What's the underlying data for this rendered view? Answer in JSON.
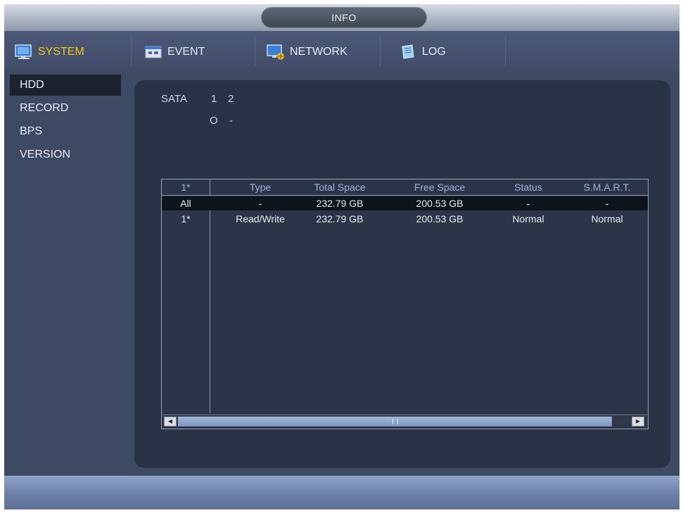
{
  "window": {
    "title": "INFO"
  },
  "tabs": [
    {
      "label": "SYSTEM",
      "icon": "system-monitor-icon",
      "active": true
    },
    {
      "label": "EVENT",
      "icon": "event-icon",
      "active": false
    },
    {
      "label": "NETWORK",
      "icon": "network-icon",
      "active": false
    },
    {
      "label": "LOG",
      "icon": "log-book-icon",
      "active": false
    }
  ],
  "sidebar": {
    "items": [
      {
        "label": "HDD",
        "active": true
      },
      {
        "label": "RECORD",
        "active": false
      },
      {
        "label": "BPS",
        "active": false
      },
      {
        "label": "VERSION",
        "active": false
      }
    ]
  },
  "sata": {
    "label": "SATA",
    "ports": [
      "1",
      "2"
    ],
    "states": [
      "O",
      "-"
    ]
  },
  "hdd_table": {
    "columns": [
      "1*",
      "Type",
      "Total Space",
      "Free Space",
      "Status",
      "S.M.A.R.T."
    ],
    "rows": [
      {
        "id": "All",
        "type": "-",
        "total": "232.79 GB",
        "free": "200.53 GB",
        "status": "-",
        "smart": "-"
      },
      {
        "id": "1*",
        "type": "Read/Write",
        "total": "232.79 GB",
        "free": "200.53 GB",
        "status": "Normal",
        "smart": "Normal"
      }
    ]
  },
  "colors": {
    "accent": "#f1c61a",
    "background": "#3f4a63",
    "panel": "#2a3246",
    "selected_row": "#0f131c"
  }
}
